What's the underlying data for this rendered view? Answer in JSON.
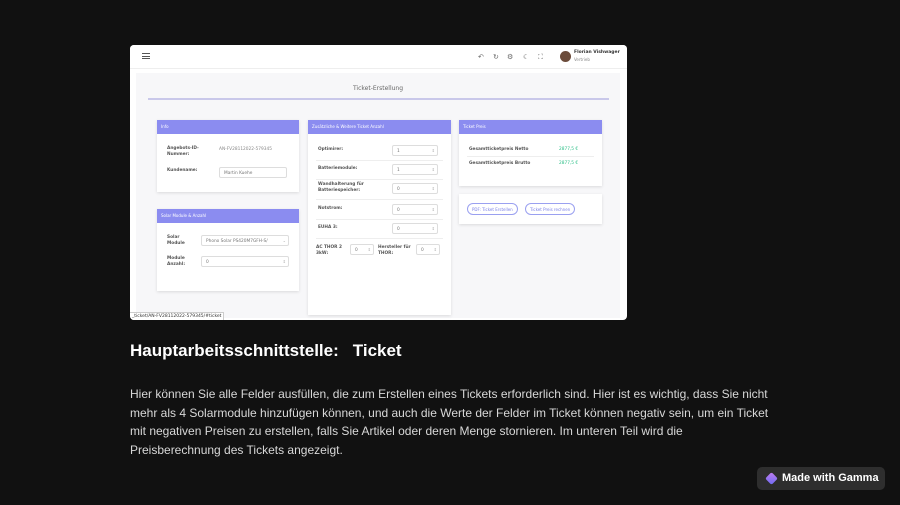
{
  "screenshot": {
    "app": {
      "user_name": "Florian Vishwager",
      "user_role": "Vertrieb",
      "page_title": "Ticket-Erstellung"
    },
    "info_card": {
      "title": "Info",
      "angebots_label_1": "Angebots-ID-",
      "angebots_label_2": "Nummer:",
      "angebots_value": "AN-FV28112022-579345",
      "kunde_label": "Kundename:",
      "kunde_placeholder": "Martin Kuehe"
    },
    "solar_card": {
      "title": "Solar Module & Anzahl",
      "modul_label_1": "Solar",
      "modul_label_2": "Module",
      "modul_value": "Phono Solar PS420M7GFH-S/",
      "anzahl_label_1": "Module",
      "anzahl_label_2": "Anzahl:",
      "anzahl_value": "0"
    },
    "extras_card": {
      "title": "Zusätzliche & Weitere Ticket Anzahl",
      "rows": [
        {
          "label": "Optimirer:",
          "value": "1"
        },
        {
          "label": "Batteriemodule:",
          "value": "1"
        },
        {
          "label": "Wandhalterung für Batteriespeicher:",
          "value": "0"
        },
        {
          "label": "Notstrom:",
          "value": "0"
        },
        {
          "label": "EUHA 3:",
          "value": "0"
        }
      ],
      "ac_label": "AC THOR 2 3kW:",
      "ac_value": "0",
      "hersteller_label": "Hersteller für THOR:",
      "hersteller_value": "0"
    },
    "price_card": {
      "title": "Ticket Preis",
      "netto_label": "Gesamtticketpreis Netto",
      "netto_value": "2877,5 €",
      "brutto_label": "Gesamtticketpreis Brutto",
      "brutto_value": "2877,5 €"
    },
    "actions": {
      "pdf_button": "PDF: Ticket Erstellen",
      "preis_button": "Ticket Preis rechnen"
    },
    "url_tooltip": "_ticket/AN-FV28112022-579345/#ticket"
  },
  "slide": {
    "heading_part1": "Hauptarbeitsschnittstelle:",
    "heading_part2": "Ticket",
    "description": "Hier können Sie alle Felder ausfüllen, die zum Erstellen eines Tickets erforderlich sind. Hier ist es wichtig, dass Sie nicht mehr als 4 Solarmodule hinzufügen können, und auch die Werte der Felder im Ticket können negativ sein, um ein Ticket mit negativen Preisen zu erstellen, falls Sie Artikel oder deren Menge stornieren. Im unteren Teil wird die Preisberechnung des Tickets angezeigt.",
    "badge": "Made with Gamma"
  },
  "colors": {
    "background": "#111111",
    "card_header": "#8b8cf0",
    "price_green": "#2bbf86"
  },
  "icons": [
    "menu-icon",
    "undo-icon",
    "refresh-icon",
    "settings-icon",
    "dark-mode-icon",
    "fullscreen-icon",
    "gamma-logo-icon"
  ]
}
